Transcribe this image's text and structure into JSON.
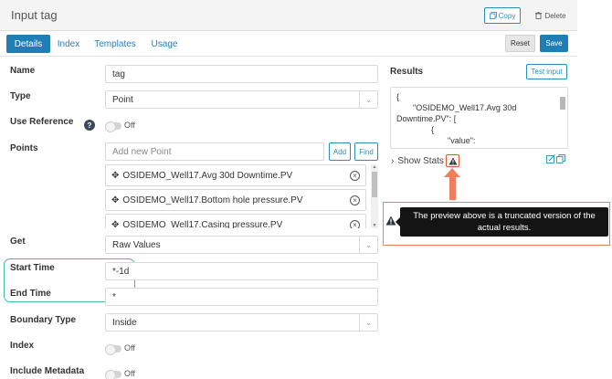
{
  "header": {
    "title": "Input tag",
    "copy_label": "Copy",
    "delete_label": "Delete"
  },
  "tabs": [
    {
      "label": "Details",
      "active": true
    },
    {
      "label": "Index",
      "active": false
    },
    {
      "label": "Templates",
      "active": false
    },
    {
      "label": "Usage",
      "active": false
    }
  ],
  "actions": {
    "reset_label": "Reset",
    "save_label": "Save"
  },
  "form": {
    "name_label": "Name",
    "name_value": "tag",
    "type_label": "Type",
    "type_value": "Point",
    "use_reference_label": "Use Reference",
    "use_reference_state": "Off",
    "points_label": "Points",
    "points_placeholder": "Add new Point",
    "add_label": "Add",
    "find_label": "Find",
    "points": [
      "OSIDEMO_Well17.Avg 30d Downtime.PV",
      "OSIDEMO_Well17.Bottom hole pressure.PV",
      "OSIDEMO_Well17.Casing pressure.PV"
    ],
    "get_label": "Get",
    "get_value": "Raw Values",
    "start_time_label": "Start Time",
    "start_time_value": "*-1d",
    "end_time_label": "End Time",
    "end_time_value": "*",
    "boundary_type_label": "Boundary Type",
    "boundary_type_value": "Inside",
    "index_label": "Index",
    "index_state": "Off",
    "include_metadata_label": "Include Metadata",
    "include_metadata_state": "Off"
  },
  "results": {
    "label": "Results",
    "test_input_label": "Test input",
    "lines": [
      "{",
      "\"OSIDEMO_Well17.Avg 30d",
      "Downtime.PV\": [",
      "{",
      "\"value\":"
    ],
    "show_stats_label": "Show Stats",
    "tooltip_text": "The preview above is a truncated version of the actual results."
  },
  "colors": {
    "accent": "#1f7fb5",
    "highlight": "#3dbfa4",
    "callout": "#ef7f5c"
  }
}
